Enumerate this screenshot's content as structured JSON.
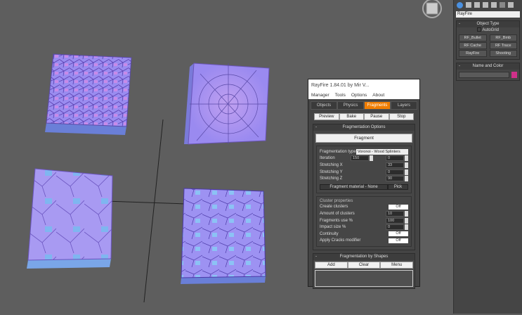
{
  "rayfire": {
    "title": "RayFire 1.84.01  by Mir V...",
    "menu": [
      "Manager",
      "Tools",
      "Options",
      "About"
    ],
    "tabs": [
      "Objects",
      "Physics",
      "Fragments",
      "Layers"
    ],
    "actions": [
      "Preview",
      "Bake",
      "Pause",
      "Stop"
    ],
    "frag_options": {
      "header": "Fragmentation Options",
      "fragment_button": "Fragment",
      "type_label": "Fragmentation type",
      "type_value": "Voronoi - Wood Splinters",
      "iteration_label": "Iteration",
      "iteration_value": "150",
      "iteration_value2": "0",
      "sx_label": "Stretching X",
      "sx_value": "33",
      "sy_label": "Stretching Y",
      "sy_value": "0",
      "sz_label": "Stretching Z",
      "sz_value": "90",
      "material_button": "Fragment material - None",
      "pick_button": "Pick"
    },
    "cluster": {
      "header": "Cluster properties",
      "create_label": "Create clusters",
      "create_value": "Off",
      "amount_label": "Amount of clusters",
      "amount_value": "10",
      "use_label": "Fragments use %",
      "use_value": "100",
      "impact_label": "Impact size %",
      "impact_value": "0",
      "cont_label": "Continuity",
      "cont_value": "Off",
      "cracks_label": "Apply Cracks modifier",
      "cracks_value": "Off"
    },
    "shapes": {
      "header": "Fragmentation by Shapes",
      "buttons": [
        "Add",
        "Clear",
        "Menu"
      ]
    }
  },
  "command_panel": {
    "dropdown": "RayFire",
    "object_type": "Object Type",
    "autogrid": "AutoGrid",
    "buttons": [
      "RF_Bullet",
      "RF_Bmb",
      "RF Cache",
      "RF Trace",
      "RayFire",
      "Shooting"
    ],
    "name_color": "Name and Color",
    "color": "#d0308a"
  },
  "colors": {
    "accent": "#f07d00"
  }
}
